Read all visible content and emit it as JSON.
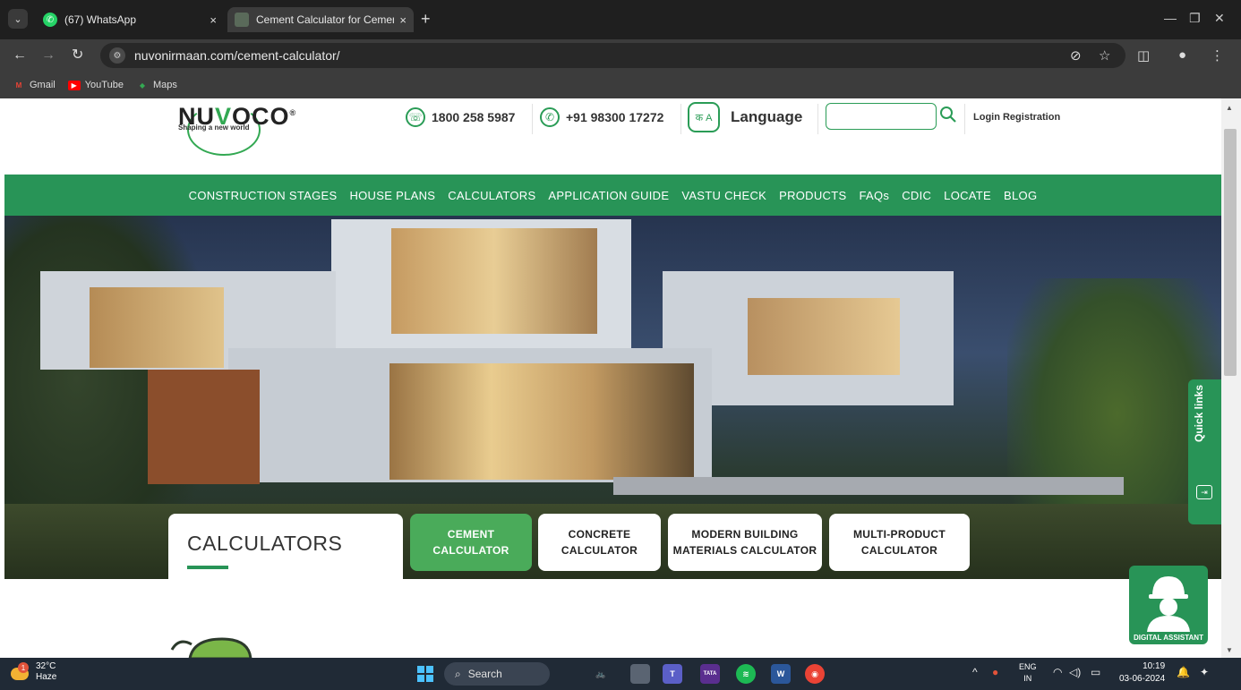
{
  "browser": {
    "tabs": [
      {
        "title": "(67) WhatsApp",
        "icon": "whatsapp-icon",
        "close": "×"
      },
      {
        "title": "Cement Calculator for Cement",
        "icon": "nuvoco-favicon",
        "close": "×"
      }
    ],
    "new_tab": "+",
    "url": "nuvonirmaan.com/cement-calculator/",
    "bookmarks": [
      {
        "label": "Gmail",
        "icon": "gmail-icon",
        "glyph": "M"
      },
      {
        "label": "YouTube",
        "icon": "youtube-icon",
        "glyph": "▶"
      },
      {
        "label": "Maps",
        "icon": "maps-icon",
        "glyph": "◆"
      }
    ]
  },
  "site": {
    "logo": {
      "prefix": "NU",
      "accent": "V",
      "suffix": "OCO",
      "reg": "®",
      "tagline": "Shaping a new world"
    },
    "phone": "1800 258 5987",
    "whatsapp": "+91 98300 17272",
    "language": "Language",
    "search": {
      "value": "",
      "placeholder": ""
    },
    "login": "Login Registration",
    "nav": [
      "CONSTRUCTION STAGES",
      "HOUSE PLANS",
      "CALCULATORS",
      "APPLICATION GUIDE",
      "VASTU CHECK",
      "PRODUCTS",
      "FAQs",
      "CDIC",
      "LOCATE",
      "BLOG"
    ],
    "calculators_heading": "CALCULATORS",
    "calc_tabs": [
      {
        "label": "CEMENT CALCULATOR",
        "active": true
      },
      {
        "label": "CONCRETE CALCULATOR",
        "active": false
      },
      {
        "label": "MODERN BUILDING MATERIALS CALCULATOR",
        "active": false
      },
      {
        "label": "MULTI-PRODUCT CALCULATOR",
        "active": false
      }
    ],
    "quick_links": "Quick links",
    "digital_assistant": "DIGITAL ASSISTANT"
  },
  "taskbar": {
    "weather": {
      "temp": "32°C",
      "condition": "Haze",
      "alert": "1"
    },
    "search": "Search",
    "lang": {
      "line1": "ENG",
      "line2": "IN"
    },
    "time": "10:19",
    "date": "03-06-2024"
  },
  "colors": {
    "brand_green": "#289457",
    "active_button": "#4aab5a",
    "chrome_dark": "#1f1f1f",
    "taskbar": "#202a36"
  }
}
